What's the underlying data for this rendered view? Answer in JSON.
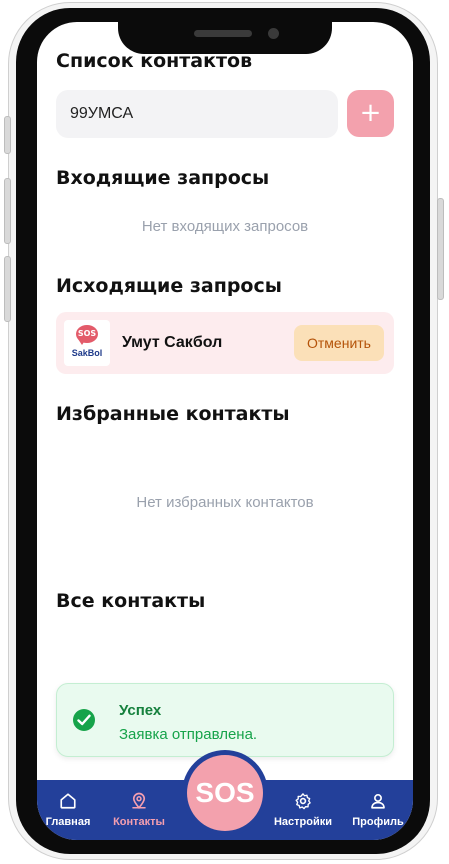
{
  "page": {
    "title": "Список контактов",
    "search": {
      "value": "99УМСА",
      "placeholder": ""
    },
    "add_label": "+"
  },
  "incoming": {
    "title": "Входящие запросы",
    "empty_text": "Нет входящих запросов"
  },
  "outgoing": {
    "title": "Исходящие запросы",
    "items": [
      {
        "logo_bubble": "SOS",
        "logo_text": "SakBol",
        "name": "Умут Сакбол",
        "cancel_label": "Отменить"
      }
    ]
  },
  "favorites": {
    "title": "Избранные контакты",
    "empty_text": "Нет избранных контактов"
  },
  "all": {
    "title": "Все контакты"
  },
  "toast": {
    "title": "Успех",
    "message": "Заявка отправлена."
  },
  "nav": {
    "home": "Главная",
    "contacts": "Контакты",
    "sos": "SOS",
    "settings": "Настройки",
    "profile": "Профиль"
  },
  "colors": {
    "accent_pink": "#f3a1ad",
    "nav_blue": "#23409a",
    "success_green": "#16a34a",
    "cancel_bg": "#fbe0b8",
    "request_bg": "#fdecee"
  },
  "icons": {
    "home": "home-icon",
    "contacts": "location-pin-icon",
    "settings": "gear-icon",
    "profile": "user-icon",
    "toast": "check-circle-icon"
  }
}
